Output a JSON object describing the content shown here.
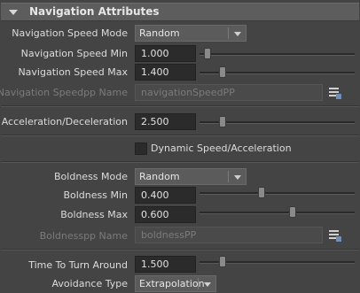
{
  "section": {
    "title": "Navigation Attributes"
  },
  "nav_speed_mode": {
    "label": "Navigation Speed Mode",
    "value": "Random"
  },
  "nav_speed_min": {
    "label": "Navigation Speed Min",
    "value": "1.000",
    "slider_fraction": 0.05
  },
  "nav_speed_max": {
    "label": "Navigation Speed Max",
    "value": "1.400",
    "slider_fraction": 0.15
  },
  "nav_speedpp": {
    "label": "Navigation Speedpp Name",
    "placeholder": "navigationSpeedPP"
  },
  "accel": {
    "label": "Acceleration/Deceleration",
    "value": "2.500",
    "slider_fraction": 0.15
  },
  "dynamic": {
    "label": "Dynamic Speed/Acceleration",
    "checked": false
  },
  "boldness_mode": {
    "label": "Boldness Mode",
    "value": "Random"
  },
  "boldness_min": {
    "label": "Boldness Min",
    "value": "0.400",
    "slider_fraction": 0.4
  },
  "boldness_max": {
    "label": "Boldness Max",
    "value": "0.600",
    "slider_fraction": 0.6
  },
  "boldnesspp": {
    "label": "Boldnesspp Name",
    "placeholder": "boldnessPP"
  },
  "time_turn": {
    "label": "Time To Turn Around",
    "value": "1.500",
    "slider_fraction": 0.15
  },
  "avoidance": {
    "label": "Avoidance Type",
    "value": "Extrapolation"
  },
  "icons": {
    "browse": "list-browse-icon"
  }
}
